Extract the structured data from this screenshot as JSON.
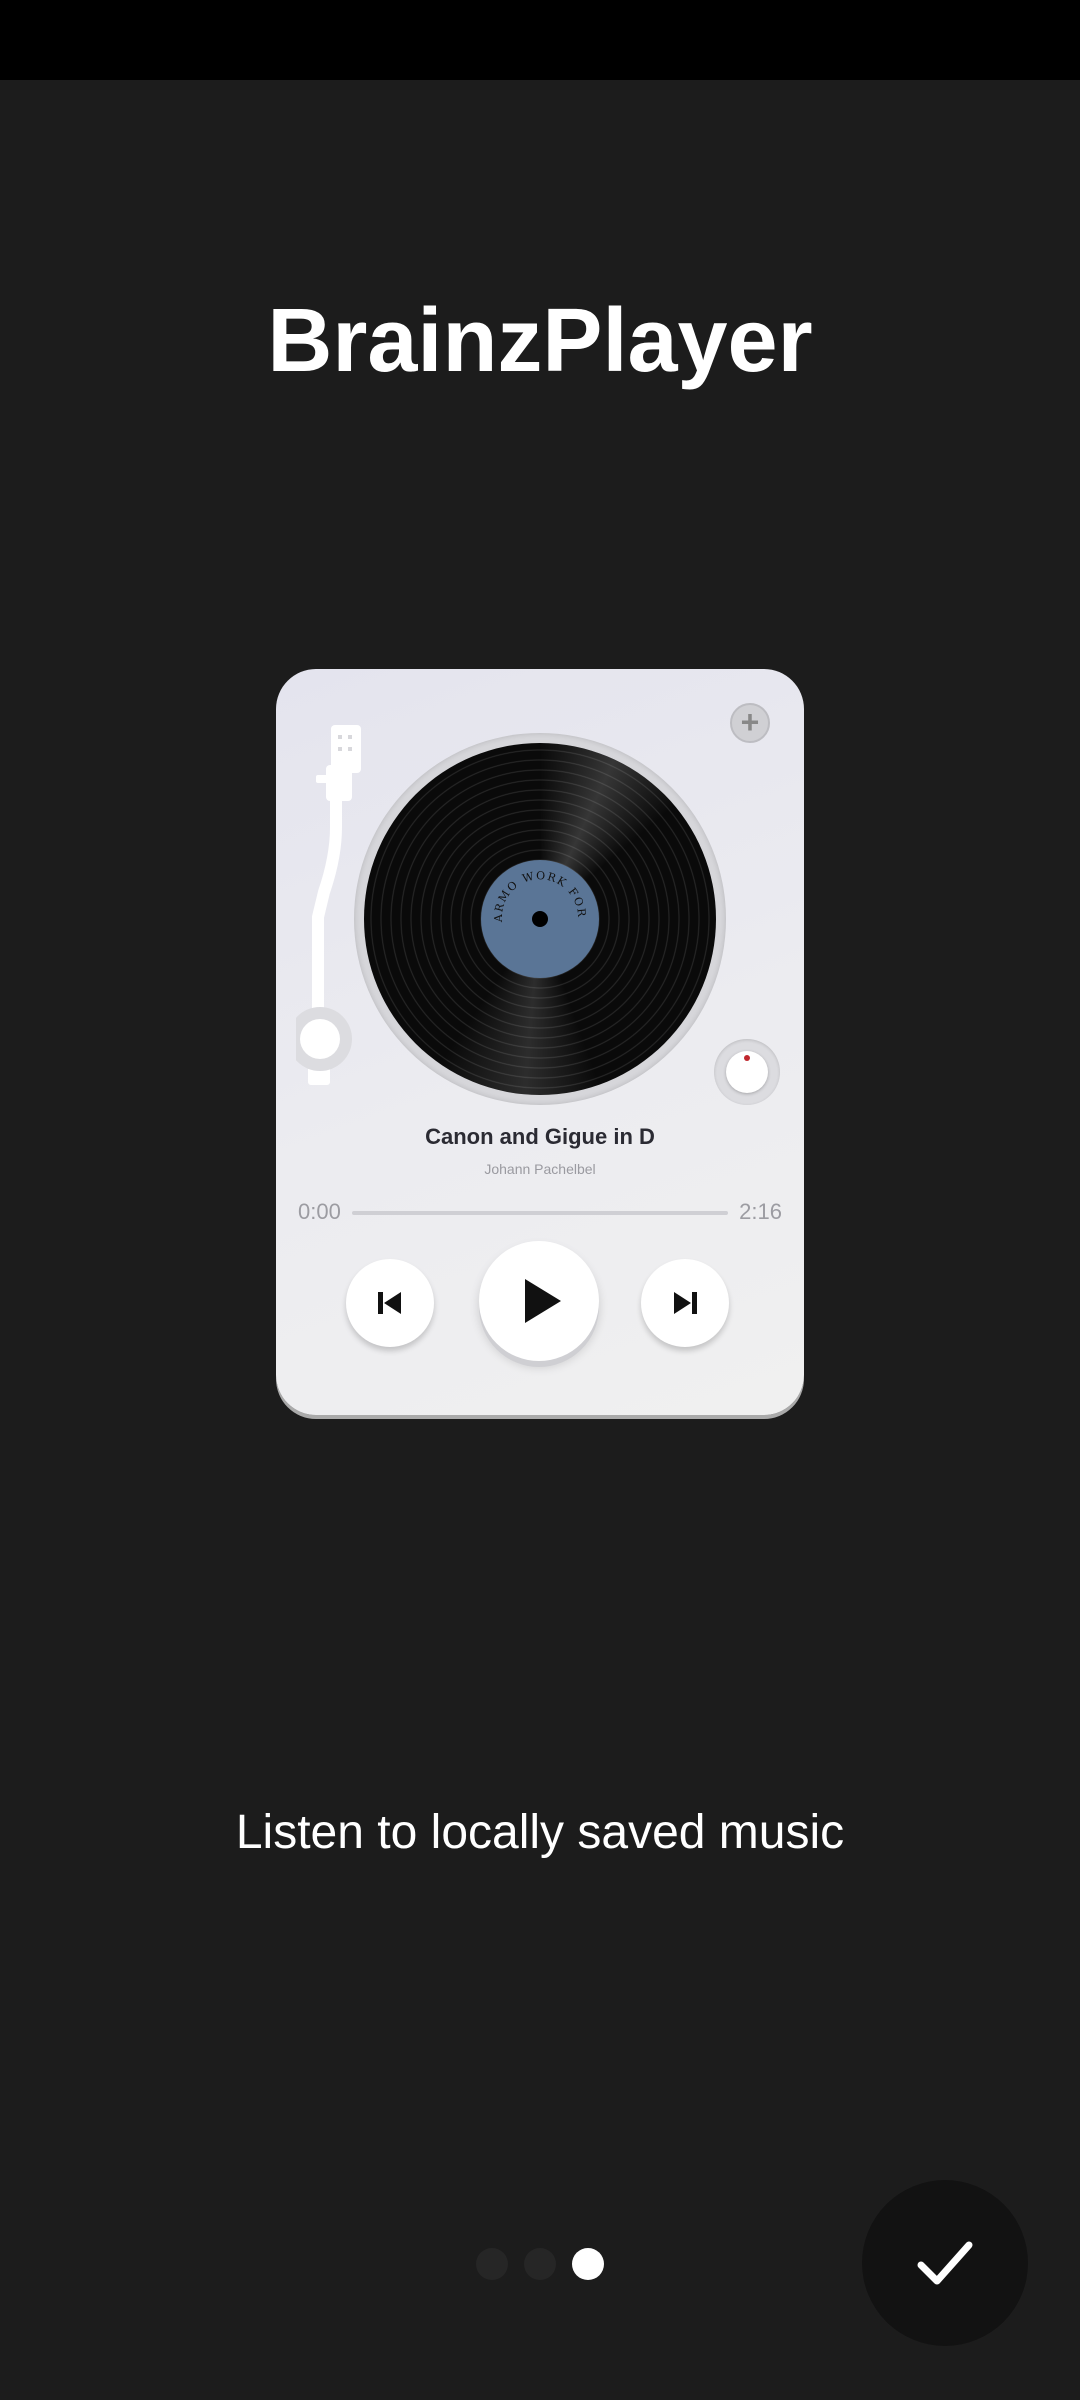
{
  "app": {
    "title": "BrainzPlayer"
  },
  "player_card": {
    "record_label_text": "ARMO WORK FOR LOTTIE",
    "track_title": "Canon and Gigue in D",
    "track_artist": "Johann Pachelbel",
    "time_elapsed": "0:00",
    "time_total": "2:16",
    "progress": 0.0,
    "icons": {
      "add": "plus-icon",
      "previous": "skip-previous-icon",
      "play": "play-icon",
      "next": "skip-next-icon"
    },
    "colors": {
      "record_label": "#5a7596",
      "knob_indicator": "#c0272d"
    }
  },
  "onboarding": {
    "subtitle": "Listen to locally saved music",
    "page_count": 3,
    "current_page": 3
  },
  "done_button": {
    "icon": "check-icon"
  }
}
